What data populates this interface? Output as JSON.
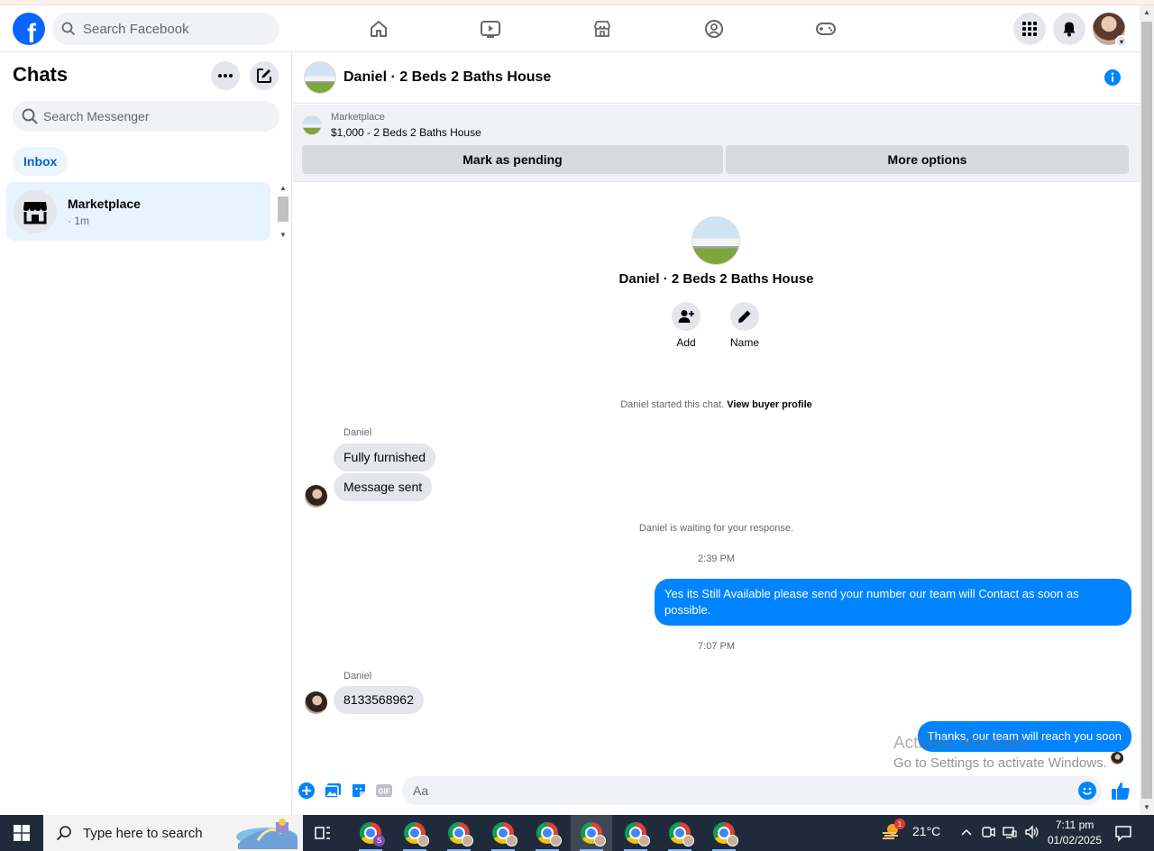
{
  "header": {
    "logo_letter": "f",
    "search_placeholder": "Search Facebook",
    "nav": [
      "home-icon",
      "video-icon",
      "marketplace-icon",
      "groups-icon",
      "gaming-icon"
    ]
  },
  "sidebar": {
    "title": "Chats",
    "search_placeholder": "Search Messenger",
    "filter": "Inbox",
    "chats": [
      {
        "name": "Marketplace",
        "time": "· 1m"
      }
    ]
  },
  "conversation": {
    "title": "Daniel · 2 Beds 2 Baths House",
    "marketplace": {
      "label": "Marketplace",
      "listing": "$1,000 - 2 Beds 2 Baths House",
      "pending_button": "Mark as pending",
      "more_button": "More options"
    },
    "profile": {
      "name": "Daniel · 2 Beds 2 Baths House",
      "add_label": "Add",
      "name_label": "Name"
    },
    "started_text": "Daniel started this chat.",
    "buyer_profile_link": "View buyer profile",
    "messages": {
      "sender1": "Daniel",
      "in1": "Fully furnished",
      "in2": "Message sent",
      "waiting": "Daniel is waiting for your response.",
      "time1": "2:39 PM",
      "out1": "Yes its Still Available please send your number our team will Contact as soon as possible.",
      "time2": "7:07 PM",
      "sender2": "Daniel",
      "in3": "8133568962",
      "out2": "Thanks, our team will reach you soon"
    },
    "composer_placeholder": "Aa"
  },
  "watermark": {
    "line1": "Activate Windows",
    "line2": "Go to Settings to activate Windows."
  },
  "taskbar": {
    "search_placeholder": "Type here to search",
    "temperature": "21°C",
    "weather_badge": "1",
    "time": "7:11 pm",
    "date": "01/02/2025",
    "chrome_badge_letter": "S"
  },
  "colors": {
    "facebook_blue": "#0866ff",
    "messenger_blue": "#0084ff",
    "inbox_text": "#0064d1"
  }
}
